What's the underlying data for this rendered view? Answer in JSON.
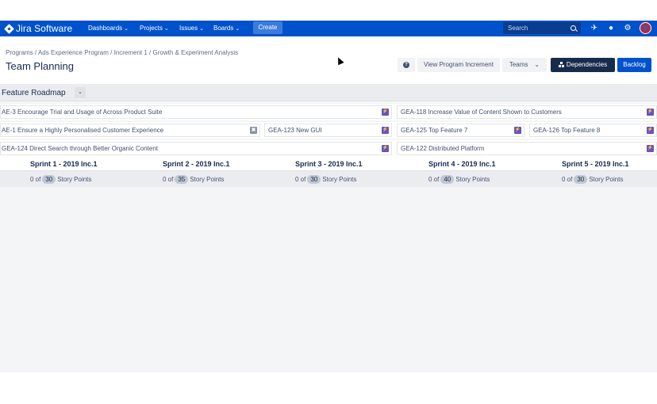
{
  "app": {
    "name": "Jira Software"
  },
  "topnav": {
    "items": [
      {
        "label": "Dashboards"
      },
      {
        "label": "Projects"
      },
      {
        "label": "Issues"
      },
      {
        "label": "Boards"
      }
    ],
    "create_label": "Create",
    "search_placeholder": "Search",
    "icons": [
      "megaphone-icon",
      "help-icon",
      "settings-icon",
      "avatar"
    ]
  },
  "header": {
    "breadcrumb": [
      "Programs",
      "Ads Experience Program",
      "Increment 1",
      "Growth & Experiment Analysis"
    ],
    "title": "Team Planning",
    "buttons": {
      "view_increment": "View Program Increment",
      "teams": "Teams",
      "dependencies": "Dependencies",
      "backlog": "Backlog"
    }
  },
  "roadmap": {
    "title": "Feature Roadmap",
    "rows": [
      [
        {
          "label": "AE-3 Encourage Trial and Usage of Across Product Suite",
          "badge": "purple"
        },
        {
          "label": "GEA-118 Increase Value of Content Shown to Customers",
          "badge": "purple"
        }
      ],
      [
        {
          "label": "AE-1 Ensure a Highly Personalised Customer Experience",
          "badge": "grey"
        },
        {
          "label": "GEA-123 New GUI",
          "badge": "purple"
        },
        {
          "label": "GEA-125 Top Feature 7",
          "badge": "purple"
        },
        {
          "label": "GEA-126 Top Feature 8",
          "badge": "purple"
        }
      ],
      [
        {
          "label": "GEA-124 Direct Search through Better Organic Content",
          "badge": "purple"
        },
        {
          "label": "GEA-122 Distributed Platform",
          "badge": "purple"
        }
      ]
    ]
  },
  "sprints": [
    {
      "name": "Sprint 1 - 2019 Inc.1",
      "done": "0",
      "total": "30",
      "unit": "Story Points"
    },
    {
      "name": "Sprint 2 - 2019 Inc.1",
      "done": "0",
      "total": "35",
      "unit": "Story Points"
    },
    {
      "name": "Sprint 3 - 2019 Inc.1",
      "done": "0",
      "total": "30",
      "unit": "Story Points"
    },
    {
      "name": "Sprint 4 - 2019 Inc.1",
      "done": "0",
      "total": "40",
      "unit": "Story Points"
    },
    {
      "name": "Sprint 5 - 2019 Inc.1",
      "done": "0",
      "total": "30",
      "unit": "Story Points"
    }
  ],
  "colors": {
    "nav": "#0052cc",
    "badge_purple": "#6554c0",
    "badge_grey": "#8993a4"
  }
}
